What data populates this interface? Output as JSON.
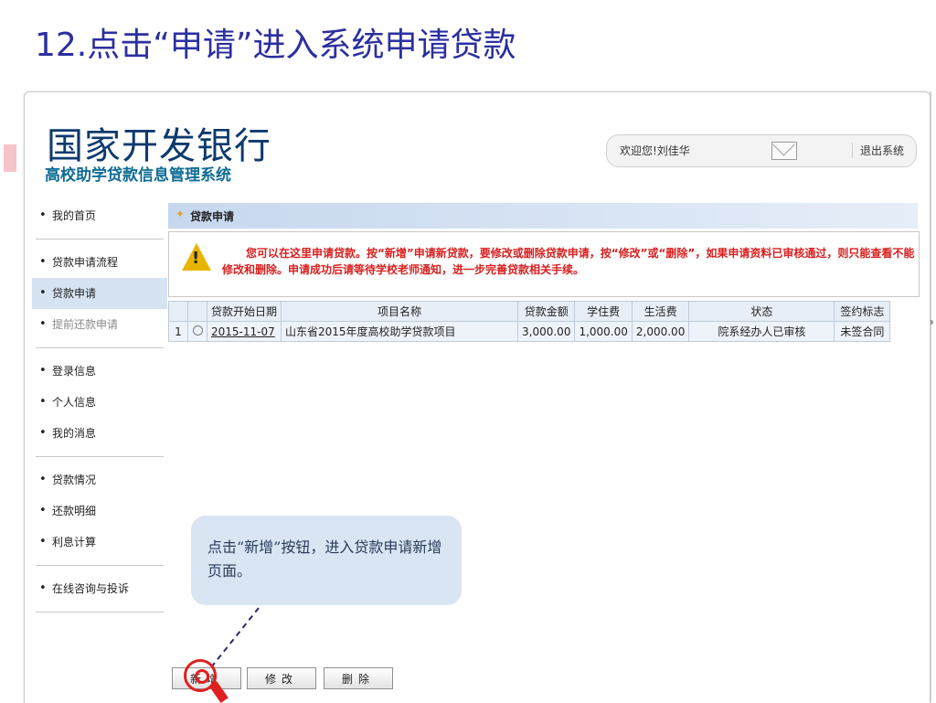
{
  "slide": {
    "title": "12.点击“申请”进入系统申请贷款"
  },
  "header": {
    "bank_name": "国家开发银行",
    "system_name": "高校助学贷款信息管理系统",
    "welcome": "欢迎您!刘佳华",
    "mail_icon": "mail-icon",
    "logout": "退出系统"
  },
  "nav": {
    "groups": [
      {
        "items": [
          {
            "label": "我的首页",
            "state": "normal"
          }
        ]
      },
      {
        "items": [
          {
            "label": "贷款申请流程",
            "state": "normal"
          },
          {
            "label": "贷款申请",
            "state": "active"
          },
          {
            "label": "提前还款申请",
            "state": "dim"
          }
        ]
      },
      {
        "items": [
          {
            "label": "登录信息",
            "state": "normal"
          },
          {
            "label": "个人信息",
            "state": "normal"
          },
          {
            "label": "我的消息",
            "state": "normal"
          }
        ]
      },
      {
        "items": [
          {
            "label": "贷款情况",
            "state": "normal"
          },
          {
            "label": "还款明细",
            "state": "normal"
          },
          {
            "label": "利息计算",
            "state": "normal"
          }
        ]
      },
      {
        "items": [
          {
            "label": "在线咨询与投诉",
            "state": "normal"
          }
        ]
      }
    ]
  },
  "panel": {
    "title": "贷款申请",
    "notice": "您可以在这里申请贷款。按“新增”申请新贷款，要修改或删除贷款申请，按“修改”或“删除”，如果申请资料已审核通过，则只能查看不能修改和删除。申请成功后请等待学校老师通知，进一步完善贷款相关手续。",
    "warning_icon": "warning-icon"
  },
  "table": {
    "columns": [
      "",
      "",
      "贷款开始日期",
      "项目名称",
      "贷款金额",
      "学住费",
      "生活费",
      "状态",
      "签约标志"
    ],
    "rows": [
      [
        "1",
        "",
        "2015-11-07",
        "山东省2015年度高校助学贷款项目",
        "3,000.00",
        "1,000.00",
        "2,000.00",
        "院系经办人已审核",
        "未签合同"
      ]
    ]
  },
  "tip": {
    "text": "点击“新增”按钮，进入贷款申请新增页面。"
  },
  "buttons": {
    "add": "新增",
    "edit": "修改",
    "delete": "删除"
  },
  "colors": {
    "title": "#2b2fa0",
    "bank": "#0e3a6e",
    "notice": "#d81f1f",
    "highlight": "#e02020"
  }
}
